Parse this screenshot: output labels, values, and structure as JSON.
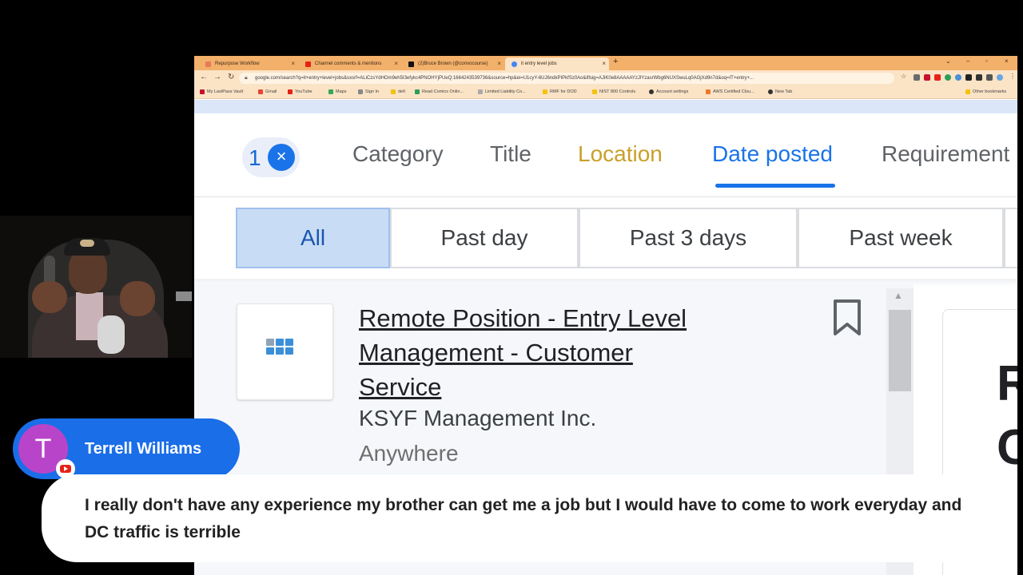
{
  "browser": {
    "tabs": [
      {
        "label": "Repurpose Workflow",
        "fav_color": "#e87a5a"
      },
      {
        "label": "Channel comments & mentions",
        "fav_color": "#e62117"
      },
      {
        "label": "(2)Bruce Brown (@convocourse)",
        "fav_color": "#111111"
      },
      {
        "label": "it entry level jobs",
        "fav_color": "#4285f4"
      }
    ],
    "new_tab_label": "+",
    "address": "google.com/search?q=it+entry+level+jobs&sxsrf=ALiCzsYdHOm9eh5I3efykc4PNOHYjPUeQ:1664243539736&source=hp&ei=U1cyY-6UJ6ndkPIPkfSz0Ao&iflsig=AJiK0e8AAAAAYzJlYzasrWbg6NUXSwuLq0AGjXd9n7d&oq=IT+entry+...",
    "bookmarks": [
      {
        "label": "My LastPass Vault",
        "color": "#c8102e"
      },
      {
        "label": "Gmail",
        "color": "#ea4335"
      },
      {
        "label": "YouTube",
        "color": "#e62117"
      },
      {
        "label": "Maps",
        "color": "#34a853"
      },
      {
        "label": "Sign In",
        "color": "#888888"
      },
      {
        "label": "defi",
        "color": "#f4c20d"
      },
      {
        "label": "Read Comics Onlin...",
        "color": "#2e9e5a"
      },
      {
        "label": "Limited Liability Co...",
        "color": "#aaaaaa"
      },
      {
        "label": "RMF for DOD",
        "color": "#f4c20d"
      },
      {
        "label": "NIST 800 Controls",
        "color": "#f4c20d"
      },
      {
        "label": "Account settings",
        "color": "#333333"
      },
      {
        "label": "AWS Certified Clou...",
        "color": "#e87a2a"
      },
      {
        "label": "New Tab",
        "color": "#333333"
      }
    ],
    "other_bookmarks": "Other bookmarks"
  },
  "filters": {
    "count": "1",
    "tabs": [
      "Category",
      "Title",
      "Location",
      "Date posted",
      "Requirement"
    ],
    "date_chips": [
      "All",
      "Past day",
      "Past 3 days",
      "Past week"
    ]
  },
  "job": {
    "title": "Remote Position - Entry Level Management - Customer Service",
    "company": "KSYF Management Inc.",
    "location": "Anywhere"
  },
  "detail": {
    "letter1": "R",
    "letter2": "C"
  },
  "chat": {
    "avatar_letter": "T",
    "author": "Terrell Williams",
    "message": "I really don't have any experience my brother can get me a job but I would have to come to work everyday and DC traffic is terrible"
  },
  "colors": {
    "accent_blue": "#1a73e8",
    "location_tab": "#c8a02a",
    "tabstrip": "#f3b06a",
    "avatar": "#b845c9",
    "chat_pill": "#1a6ee8"
  }
}
